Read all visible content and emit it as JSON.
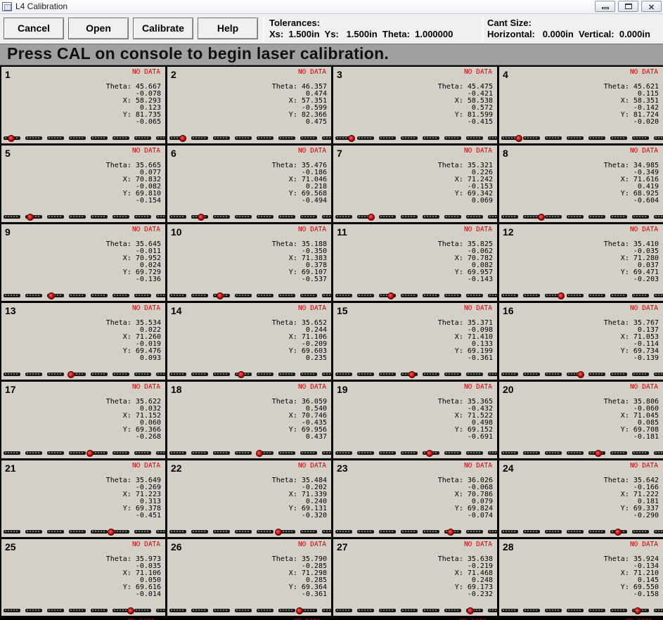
{
  "window": {
    "title": "L4 Calibration"
  },
  "toolbar": {
    "buttons": [
      "Cancel",
      "Open",
      "Calibrate",
      "Help"
    ],
    "tolerances": {
      "heading": "Tolerances:",
      "line": "Xs:  1.500in  Ys:   1.500in  Theta:  1.000000"
    },
    "cant": {
      "heading": "Cant Size:",
      "line": "Horizontal:   0.000in  Vertical:  0.000in"
    }
  },
  "banner": "Press CAL on console to begin laser calibration.",
  "labels": {
    "nodata": "NO DATA",
    "theta": "Theta:",
    "x": "X:",
    "y": "Y:"
  },
  "cells": [
    {
      "n": "1",
      "theta": "45.667",
      "theta_d": "-0.078",
      "x": "58.293",
      "x_d": "0.123",
      "y": "81.735",
      "y_d": "-0.065",
      "marker": 0.04
    },
    {
      "n": "2",
      "theta": "46.357",
      "theta_d": "0.474",
      "x": "57.351",
      "x_d": "-0.599",
      "y": "82.366",
      "y_d": "0.475",
      "marker": 0.08
    },
    {
      "n": "3",
      "theta": "45.475",
      "theta_d": "-0.421",
      "x": "58.538",
      "x_d": "0.572",
      "y": "81.599",
      "y_d": "-0.415",
      "marker": 0.1
    },
    {
      "n": "4",
      "theta": "45.621",
      "theta_d": "0.115",
      "x": "58.351",
      "x_d": "-0.142",
      "y": "81.724",
      "y_d": "-0.020",
      "marker": 0.11
    },
    {
      "n": "5",
      "theta": "35.665",
      "theta_d": "0.077",
      "x": "70.832",
      "x_d": "-0.082",
      "y": "69.810",
      "y_d": "-0.154",
      "marker": 0.17
    },
    {
      "n": "6",
      "theta": "35.476",
      "theta_d": "-0.186",
      "x": "71.046",
      "x_d": "0.218",
      "y": "69.568",
      "y_d": "-0.494",
      "marker": 0.2
    },
    {
      "n": "7",
      "theta": "35.321",
      "theta_d": "0.226",
      "x": "71.242",
      "x_d": "-0.153",
      "y": "69.342",
      "y_d": "0.069",
      "marker": 0.23
    },
    {
      "n": "8",
      "theta": "34.985",
      "theta_d": "-0.349",
      "x": "71.616",
      "x_d": "0.419",
      "y": "68.925",
      "y_d": "-0.604",
      "marker": 0.26
    },
    {
      "n": "9",
      "theta": "35.645",
      "theta_d": "-0.011",
      "x": "70.952",
      "x_d": "0.024",
      "y": "69.729",
      "y_d": "-0.136",
      "marker": 0.31
    },
    {
      "n": "10",
      "theta": "35.188",
      "theta_d": "-0.350",
      "x": "71.383",
      "x_d": "0.378",
      "y": "69.107",
      "y_d": "-0.537",
      "marker": 0.33
    },
    {
      "n": "11",
      "theta": "35.825",
      "theta_d": "-0.062",
      "x": "70.782",
      "x_d": "0.082",
      "y": "69.957",
      "y_d": "-0.143",
      "marker": 0.36
    },
    {
      "n": "12",
      "theta": "35.410",
      "theta_d": "-0.035",
      "x": "71.280",
      "x_d": "0.037",
      "y": "69.471",
      "y_d": "-0.203",
      "marker": 0.39
    },
    {
      "n": "13",
      "theta": "35.534",
      "theta_d": "0.022",
      "x": "71.260",
      "x_d": "-0.019",
      "y": "69.476",
      "y_d": "0.093",
      "marker": 0.44
    },
    {
      "n": "14",
      "theta": "35.652",
      "theta_d": "0.244",
      "x": "71.106",
      "x_d": "-0.209",
      "y": "69.603",
      "y_d": "0.235",
      "marker": 0.47
    },
    {
      "n": "15",
      "theta": "35.371",
      "theta_d": "-0.098",
      "x": "71.410",
      "x_d": "0.133",
      "y": "69.199",
      "y_d": "-0.361",
      "marker": 0.5
    },
    {
      "n": "16",
      "theta": "35.767",
      "theta_d": "0.137",
      "x": "71.053",
      "x_d": "-0.114",
      "y": "69.734",
      "y_d": "-0.139",
      "marker": 0.52
    },
    {
      "n": "17",
      "theta": "35.622",
      "theta_d": "0.032",
      "x": "71.152",
      "x_d": "0.060",
      "y": "69.366",
      "y_d": "-0.268",
      "marker": 0.57
    },
    {
      "n": "18",
      "theta": "36.059",
      "theta_d": "0.540",
      "x": "70.746",
      "x_d": "-0.435",
      "y": "69.956",
      "y_d": "0.437",
      "marker": 0.59
    },
    {
      "n": "19",
      "theta": "35.365",
      "theta_d": "-0.432",
      "x": "71.522",
      "x_d": "0.498",
      "y": "69.152",
      "y_d": "-0.691",
      "marker": 0.62
    },
    {
      "n": "20",
      "theta": "35.806",
      "theta_d": "-0.060",
      "x": "71.045",
      "x_d": "0.085",
      "y": "69.708",
      "y_d": "-0.181",
      "marker": 0.64
    },
    {
      "n": "21",
      "theta": "35.649",
      "theta_d": "-0.269",
      "x": "71.223",
      "x_d": "0.313",
      "y": "69.378",
      "y_d": "-0.451",
      "marker": 0.71
    },
    {
      "n": "22",
      "theta": "35.484",
      "theta_d": "-0.202",
      "x": "71.339",
      "x_d": "0.240",
      "y": "69.131",
      "y_d": "-0.320",
      "marker": 0.72
    },
    {
      "n": "23",
      "theta": "36.026",
      "theta_d": "-0.068",
      "x": "70.786",
      "x_d": "0.079",
      "y": "69.824",
      "y_d": "-0.074",
      "marker": 0.76
    },
    {
      "n": "24",
      "theta": "35.642",
      "theta_d": "-0.166",
      "x": "71.222",
      "x_d": "0.181",
      "y": "69.337",
      "y_d": "-0.290",
      "marker": 0.77
    },
    {
      "n": "25",
      "theta": "35.973",
      "theta_d": "-0.035",
      "x": "71.106",
      "x_d": "0.050",
      "y": "69.616",
      "y_d": "-0.014",
      "marker": 0.84
    },
    {
      "n": "26",
      "theta": "35.790",
      "theta_d": "-0.285",
      "x": "71.298",
      "x_d": "0.285",
      "y": "69.364",
      "y_d": "-0.361",
      "marker": 0.86
    },
    {
      "n": "27",
      "theta": "35.638",
      "theta_d": "-0.219",
      "x": "71.468",
      "x_d": "0.248",
      "y": "69.173",
      "y_d": "-0.232",
      "marker": 0.89
    },
    {
      "n": "28",
      "theta": "35.924",
      "theta_d": "-0.134",
      "x": "71.210",
      "x_d": "0.145",
      "y": "69.550",
      "y_d": "-0.158",
      "marker": 0.9
    }
  ],
  "colors": {
    "panel": "#d4d0c8",
    "grid_lines": "#000000",
    "banner": "#a0a0a0",
    "nodata": "#e00000",
    "marker": "#c00000"
  }
}
